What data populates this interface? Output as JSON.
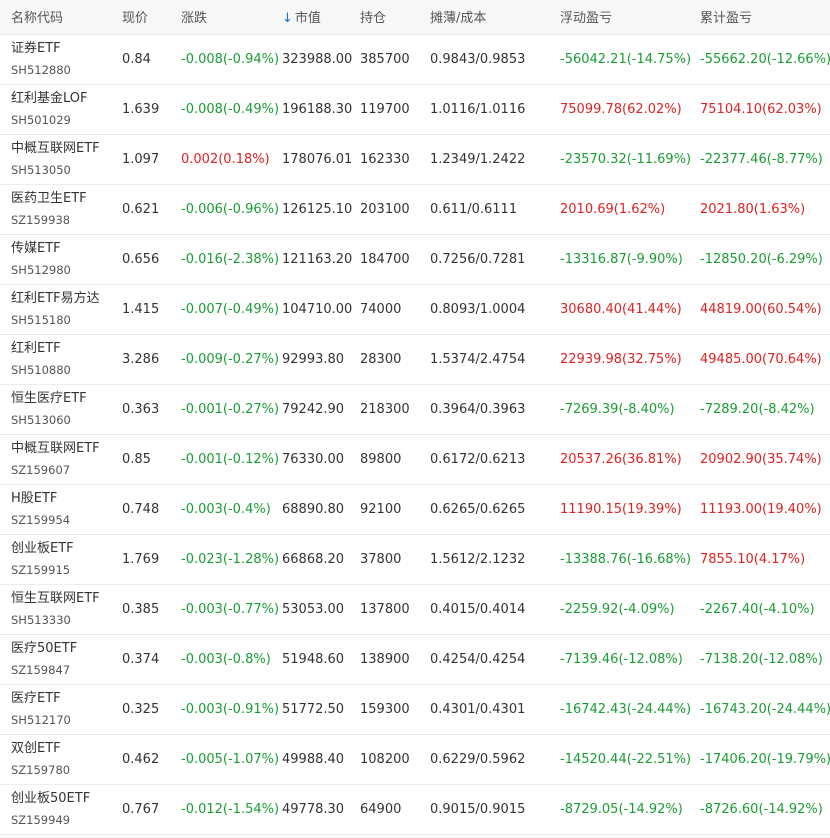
{
  "colors": {
    "up": "#e02222",
    "down": "#1a9d34",
    "sort_icon": "#1e6fd9",
    "header_bg": "#f7f7f7"
  },
  "header": {
    "name": "名称代码",
    "price": "现价",
    "change": "涨跌",
    "sort_icon": "↓",
    "market_value": "市值",
    "holding": "持仓",
    "cost": "摊薄/成本",
    "float_pl": "浮动盈亏",
    "cum_pl": "累计盈亏"
  },
  "rows": [
    {
      "name": "证券ETF",
      "code": "SH512880",
      "price": "0.84",
      "change": "-0.008(-0.94%)",
      "change_dir": "down",
      "market_value": "323988.00",
      "holding": "385700",
      "cost": "0.9843/0.9853",
      "float_pl": "-56042.21(-14.75%)",
      "float_dir": "down",
      "cum_pl": "-55662.20(-12.66%)",
      "cum_dir": "down"
    },
    {
      "name": "红利基金LOF",
      "code": "SH501029",
      "price": "1.639",
      "change": "-0.008(-0.49%)",
      "change_dir": "down",
      "market_value": "196188.30",
      "holding": "119700",
      "cost": "1.0116/1.0116",
      "float_pl": "75099.78(62.02%)",
      "float_dir": "up",
      "cum_pl": "75104.10(62.03%)",
      "cum_dir": "up"
    },
    {
      "name": "中概互联网ETF",
      "code": "SH513050",
      "price": "1.097",
      "change": "0.002(0.18%)",
      "change_dir": "up",
      "market_value": "178076.01",
      "holding": "162330",
      "cost": "1.2349/1.2422",
      "float_pl": "-23570.32(-11.69%)",
      "float_dir": "down",
      "cum_pl": "-22377.46(-8.77%)",
      "cum_dir": "down"
    },
    {
      "name": "医药卫生ETF",
      "code": "SZ159938",
      "price": "0.621",
      "change": "-0.006(-0.96%)",
      "change_dir": "down",
      "market_value": "126125.10",
      "holding": "203100",
      "cost": "0.611/0.6111",
      "float_pl": "2010.69(1.62%)",
      "float_dir": "up",
      "cum_pl": "2021.80(1.63%)",
      "cum_dir": "up"
    },
    {
      "name": "传媒ETF",
      "code": "SH512980",
      "price": "0.656",
      "change": "-0.016(-2.38%)",
      "change_dir": "down",
      "market_value": "121163.20",
      "holding": "184700",
      "cost": "0.7256/0.7281",
      "float_pl": "-13316.87(-9.90%)",
      "float_dir": "down",
      "cum_pl": "-12850.20(-6.29%)",
      "cum_dir": "down"
    },
    {
      "name": "红利ETF易方达",
      "code": "SH515180",
      "price": "1.415",
      "change": "-0.007(-0.49%)",
      "change_dir": "down",
      "market_value": "104710.00",
      "holding": "74000",
      "cost": "0.8093/1.0004",
      "float_pl": "30680.40(41.44%)",
      "float_dir": "up",
      "cum_pl": "44819.00(60.54%)",
      "cum_dir": "up"
    },
    {
      "name": "红利ETF",
      "code": "SH510880",
      "price": "3.286",
      "change": "-0.009(-0.27%)",
      "change_dir": "down",
      "market_value": "92993.80",
      "holding": "28300",
      "cost": "1.5374/2.4754",
      "float_pl": "22939.98(32.75%)",
      "float_dir": "up",
      "cum_pl": "49485.00(70.64%)",
      "cum_dir": "up"
    },
    {
      "name": "恒生医疗ETF",
      "code": "SH513060",
      "price": "0.363",
      "change": "-0.001(-0.27%)",
      "change_dir": "down",
      "market_value": "79242.90",
      "holding": "218300",
      "cost": "0.3964/0.3963",
      "float_pl": "-7269.39(-8.40%)",
      "float_dir": "down",
      "cum_pl": "-7289.20(-8.42%)",
      "cum_dir": "down"
    },
    {
      "name": "中概互联网ETF",
      "code": "SZ159607",
      "price": "0.85",
      "change": "-0.001(-0.12%)",
      "change_dir": "down",
      "market_value": "76330.00",
      "holding": "89800",
      "cost": "0.6172/0.6213",
      "float_pl": "20537.26(36.81%)",
      "float_dir": "up",
      "cum_pl": "20902.90(35.74%)",
      "cum_dir": "up"
    },
    {
      "name": "H股ETF",
      "code": "SZ159954",
      "price": "0.748",
      "change": "-0.003(-0.4%)",
      "change_dir": "down",
      "market_value": "68890.80",
      "holding": "92100",
      "cost": "0.6265/0.6265",
      "float_pl": "11190.15(19.39%)",
      "float_dir": "up",
      "cum_pl": "11193.00(19.40%)",
      "cum_dir": "up"
    },
    {
      "name": "创业板ETF",
      "code": "SZ159915",
      "price": "1.769",
      "change": "-0.023(-1.28%)",
      "change_dir": "down",
      "market_value": "66868.20",
      "holding": "37800",
      "cost": "1.5612/2.1232",
      "float_pl": "-13388.76(-16.68%)",
      "float_dir": "down",
      "cum_pl": "7855.10(4.17%)",
      "cum_dir": "up"
    },
    {
      "name": "恒生互联网ETF",
      "code": "SH513330",
      "price": "0.385",
      "change": "-0.003(-0.77%)",
      "change_dir": "down",
      "market_value": "53053.00",
      "holding": "137800",
      "cost": "0.4015/0.4014",
      "float_pl": "-2259.92(-4.09%)",
      "float_dir": "down",
      "cum_pl": "-2267.40(-4.10%)",
      "cum_dir": "down"
    },
    {
      "name": "医疗50ETF",
      "code": "SZ159847",
      "price": "0.374",
      "change": "-0.003(-0.8%)",
      "change_dir": "down",
      "market_value": "51948.60",
      "holding": "138900",
      "cost": "0.4254/0.4254",
      "float_pl": "-7139.46(-12.08%)",
      "float_dir": "down",
      "cum_pl": "-7138.20(-12.08%)",
      "cum_dir": "down"
    },
    {
      "name": "医疗ETF",
      "code": "SH512170",
      "price": "0.325",
      "change": "-0.003(-0.91%)",
      "change_dir": "down",
      "market_value": "51772.50",
      "holding": "159300",
      "cost": "0.4301/0.4301",
      "float_pl": "-16742.43(-24.44%)",
      "float_dir": "down",
      "cum_pl": "-16743.20(-24.44%)",
      "cum_dir": "down"
    },
    {
      "name": "双创ETF",
      "code": "SZ159780",
      "price": "0.462",
      "change": "-0.005(-1.07%)",
      "change_dir": "down",
      "market_value": "49988.40",
      "holding": "108200",
      "cost": "0.6229/0.5962",
      "float_pl": "-14520.44(-22.51%)",
      "float_dir": "down",
      "cum_pl": "-17406.20(-19.79%)",
      "cum_dir": "down"
    },
    {
      "name": "创业板50ETF",
      "code": "SZ159949",
      "price": "0.767",
      "change": "-0.012(-1.54%)",
      "change_dir": "down",
      "market_value": "49778.30",
      "holding": "64900",
      "cost": "0.9015/0.9015",
      "float_pl": "-8729.05(-14.92%)",
      "float_dir": "down",
      "cum_pl": "-8726.60(-14.92%)",
      "cum_dir": "down"
    }
  ]
}
